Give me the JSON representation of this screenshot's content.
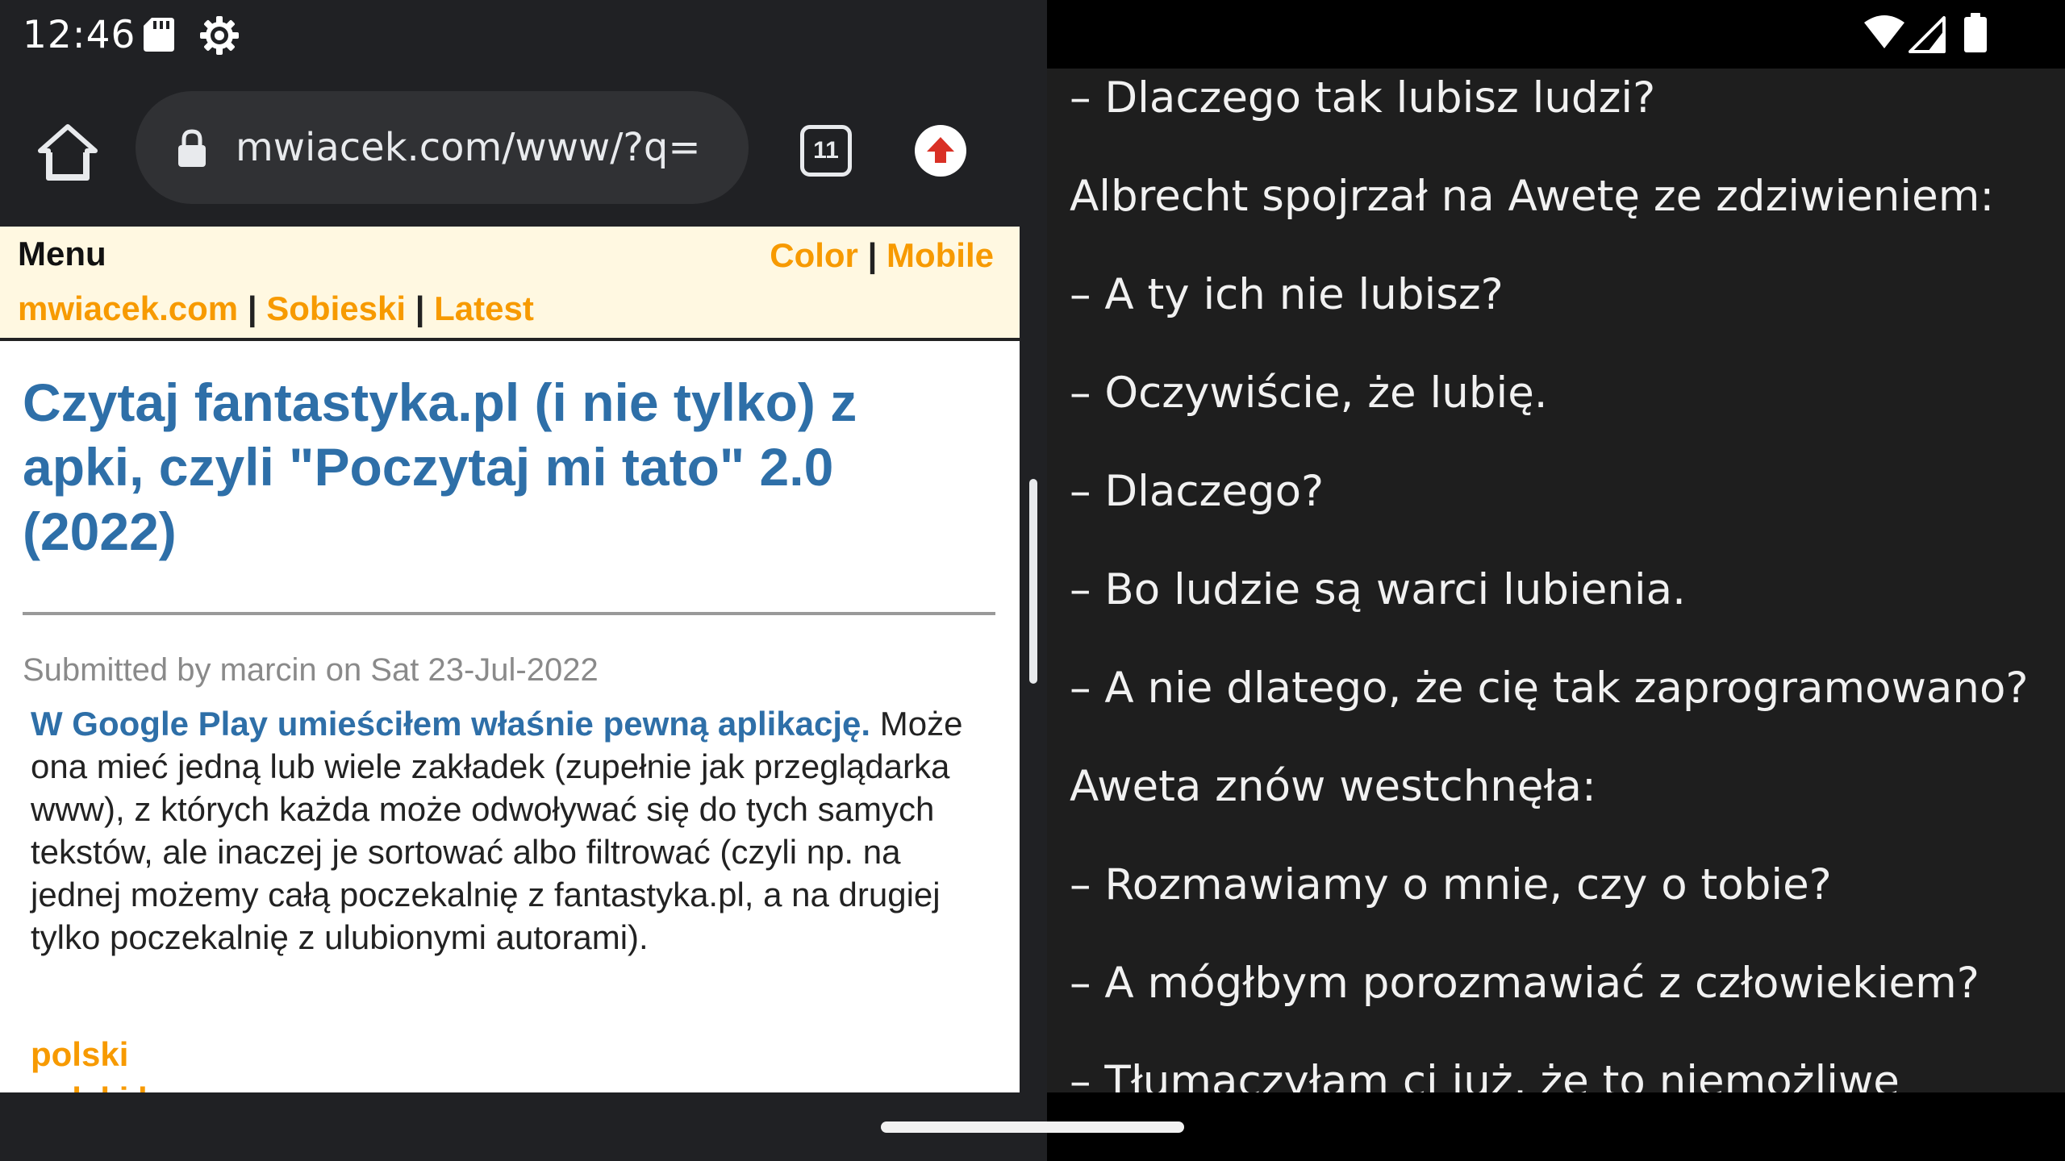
{
  "status_bar": {
    "time": "12:46",
    "left_icons": [
      "sd-card-icon",
      "settings-gear-icon"
    ],
    "right_icons": [
      "wifi-icon",
      "cell-signal-icon",
      "battery-icon"
    ]
  },
  "browser": {
    "url": "mwiacek.com/www/?q=",
    "tab_count": "11",
    "icons": [
      "home-icon",
      "lock-icon",
      "tab-switcher-icon",
      "update-available-icon"
    ]
  },
  "page": {
    "menu_title": "Menu",
    "top_links": [
      "Color",
      "Mobile"
    ],
    "nav_links": [
      "mwiacek.com",
      "Sobieski",
      "Latest"
    ],
    "separator": "|",
    "article_title": "Czytaj fantastyka.pl (i nie tylko) z apki, czyli \"Poczytaj mi tato\" 2.0 (2022)",
    "submitted": "Submitted by marcin on Sat 23-Jul-2022",
    "body_link": "W Google Play umieściłem właśnie pewną aplikację.",
    "body_rest": " Może ona mieć jedną lub wiele zakładek (zupełnie jak przeglądarka www), z których każda może odwoływać się do tych samych tekstów, ale inaczej je sortować albo filtrować (czyli np. na jednej możemy całą poczekalnię z fantastyka.pl, a na drugiej tylko poczekalnię z ulubionymi autorami).",
    "tags": [
      "polski",
      "polski k"
    ]
  },
  "reader": {
    "paragraphs": [
      "– Dlaczego tak lubisz ludzi?",
      "Albrecht spojrzał na Awetę ze zdziwieniem:",
      "– A ty ich nie lubisz?",
      "– Oczywiście, że lubię.",
      "– Dlaczego?",
      "– Bo ludzie są warci lubienia.",
      "– A nie dlatego, że cię tak zaprogramowano?",
      "Aweta znów westchnęła:",
      "– Rozmawiamy o mnie, czy o tobie?",
      "– A mógłbym porozmawiać z człowiekiem?",
      "– Tłumaczyłam ci już, że to niemożliwe"
    ]
  }
}
